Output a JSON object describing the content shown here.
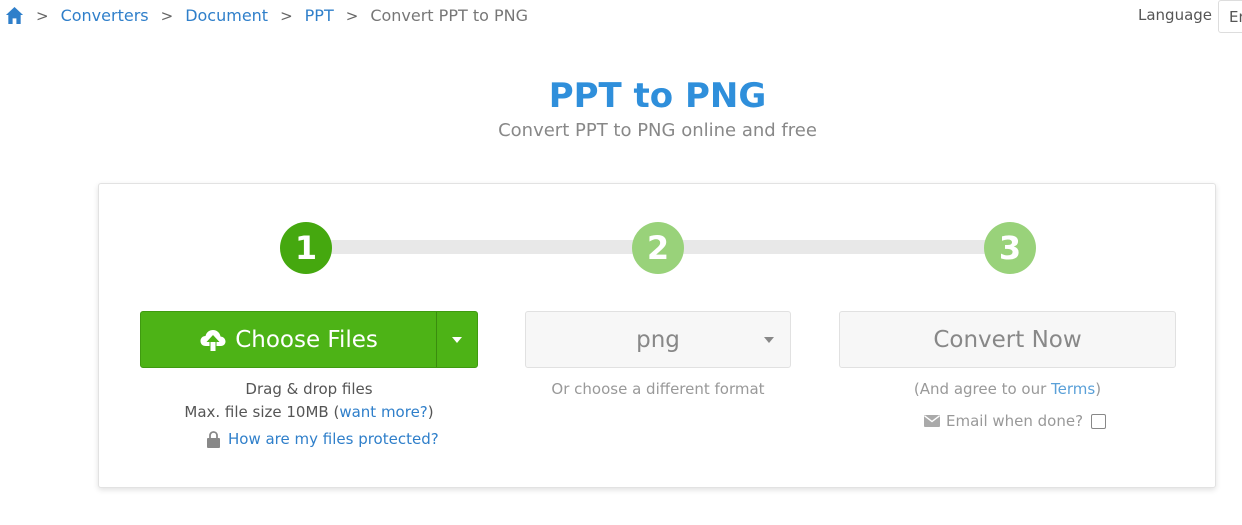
{
  "breadcrumb": {
    "items": [
      "Converters",
      "Document",
      "PPT"
    ],
    "current": "Convert PPT to PNG",
    "separator": ">"
  },
  "language": {
    "label": "Language",
    "value": "En"
  },
  "header": {
    "title": "PPT to PNG",
    "subtitle": "Convert PPT to PNG online and free"
  },
  "steps": [
    "1",
    "2",
    "3"
  ],
  "upload": {
    "button_label": "Choose Files",
    "drag_text": "Drag & drop files",
    "max_size_prefix": "Max. file size 10MB (",
    "want_more": "want more?",
    "max_size_suffix": ")",
    "protect_link": "How are my files protected?"
  },
  "format": {
    "selected": "png",
    "hint": "Or choose a different format"
  },
  "convert": {
    "button_label": "Convert Now",
    "agree_prefix": "(And agree to our ",
    "terms_link": "Terms",
    "agree_suffix": ")",
    "email_label": "Email when done?",
    "email_checked": false
  },
  "colors": {
    "accent_blue": "#2f8fdb",
    "link_blue": "#2f7fca",
    "primary_green": "#4db316",
    "step_active": "#45a80f",
    "step_inactive": "#99d27a"
  }
}
